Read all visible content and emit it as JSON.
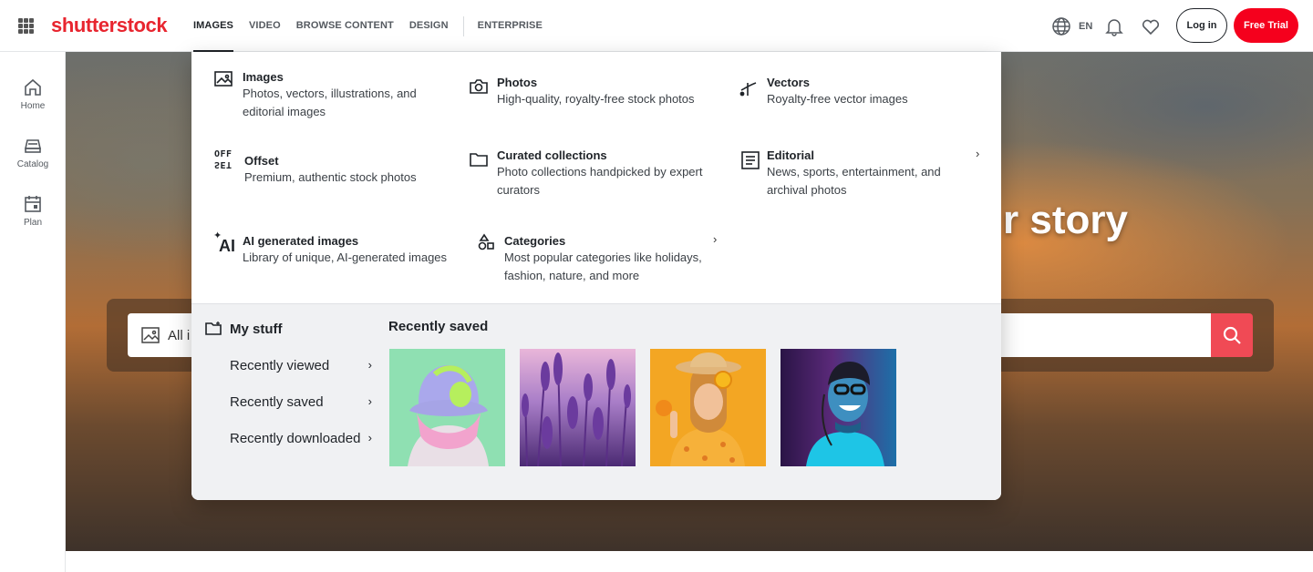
{
  "header": {
    "logo": "shutterstock",
    "nav": [
      "IMAGES",
      "VIDEO",
      "BROWSE CONTENT",
      "DESIGN"
    ],
    "enterprise": "ENTERPRISE",
    "language": "EN",
    "login_label": "Log in",
    "trial_label": "Free Trial",
    "icons": [
      "apps-grid-icon",
      "globe-icon",
      "bell-icon",
      "heart-icon"
    ]
  },
  "rail": {
    "items": [
      {
        "label": "Home",
        "icon": "home-icon"
      },
      {
        "label": "Catalog",
        "icon": "catalog-icon"
      },
      {
        "label": "Plan",
        "icon": "plan-icon"
      }
    ]
  },
  "hero": {
    "title": "r story",
    "search_placeholder": "All i"
  },
  "dropdown": {
    "options": [
      {
        "title": "Images",
        "desc": "Photos, vectors, illustrations, and editorial images",
        "icon": "image-icon"
      },
      {
        "title": "Photos",
        "desc": "High-quality, royalty-free stock photos",
        "icon": "camera-icon"
      },
      {
        "title": "Vectors",
        "desc": "Royalty-free vector images",
        "icon": "vector-pen-icon"
      },
      {
        "title": "Offset",
        "desc": "Premium, authentic stock photos",
        "icon": "offset-logo-icon"
      },
      {
        "title": "Curated collections",
        "desc": "Photo collections handpicked by expert curators",
        "icon": "folder-icon"
      },
      {
        "title": "Editorial",
        "desc": "News, sports, entertainment, and archival photos",
        "icon": "newspaper-icon"
      },
      {
        "title": "AI generated images",
        "desc": "Library of unique, AI-generated images",
        "icon": "ai-sparkle-icon"
      },
      {
        "title": "Categories",
        "desc": "Most popular categories like holidays, fashion, nature, and more",
        "icon": "shapes-icon"
      }
    ],
    "offset_logo": "OFFSET",
    "ai_logo": "AI",
    "my_stuff": {
      "title": "My stuff",
      "links": [
        "Recently viewed",
        "Recently saved",
        "Recently downloaded"
      ]
    },
    "recently_saved": {
      "title": "Recently saved",
      "thumbs": [
        {
          "subject": "person with pink hair and green headphones",
          "bg": "#8fe0b2"
        },
        {
          "subject": "lavender flowers",
          "bg": "#a074c4"
        },
        {
          "subject": "woman with straw hat holding orange",
          "bg": "#f3a623"
        },
        {
          "subject": "smiling man with glasses and headphones in neon light",
          "bg": "#1b6fa8"
        }
      ]
    }
  }
}
